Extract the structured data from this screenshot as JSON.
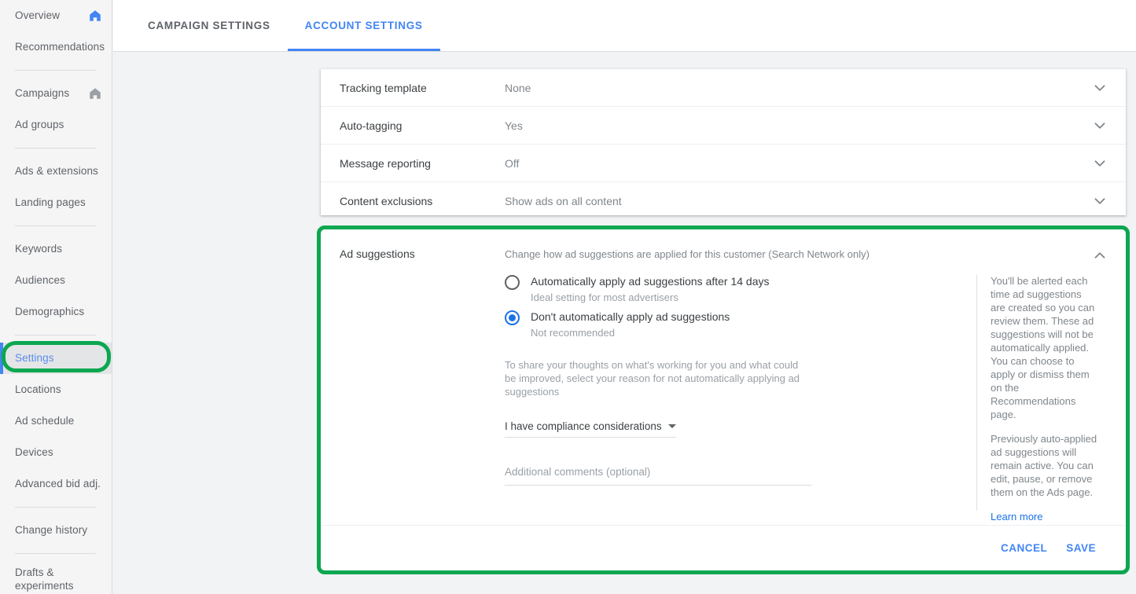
{
  "colors": {
    "accent_blue": "#4285f4",
    "link_blue": "#1a73e8",
    "highlight_green": "#0ca750",
    "sidebar_bg": "#f5f5f5",
    "content_bg": "#f1f3f4"
  },
  "sidebar": {
    "items": [
      {
        "label": "Overview",
        "icon": "home-icon",
        "icon_color": "blue",
        "selected": false
      },
      {
        "label": "Recommendations",
        "icon": null,
        "selected": false
      },
      {
        "separator": true
      },
      {
        "label": "Campaigns",
        "icon": "home-icon",
        "icon_color": "gray",
        "selected": false
      },
      {
        "label": "Ad groups",
        "icon": null,
        "selected": false
      },
      {
        "separator": true
      },
      {
        "label": "Ads & extensions",
        "icon": null,
        "selected": false
      },
      {
        "label": "Landing pages",
        "icon": null,
        "selected": false
      },
      {
        "separator": true
      },
      {
        "label": "Keywords",
        "icon": null,
        "selected": false
      },
      {
        "label": "Audiences",
        "icon": null,
        "selected": false
      },
      {
        "label": "Demographics",
        "icon": null,
        "selected": false
      },
      {
        "separator": true
      },
      {
        "label": "Settings",
        "icon": null,
        "selected": true
      },
      {
        "label": "Locations",
        "icon": null,
        "selected": false
      },
      {
        "label": "Ad schedule",
        "icon": null,
        "selected": false
      },
      {
        "label": "Devices",
        "icon": null,
        "selected": false
      },
      {
        "label": "Advanced bid adj.",
        "icon": null,
        "selected": false
      },
      {
        "separator": true
      },
      {
        "label": "Change history",
        "icon": null,
        "selected": false
      },
      {
        "separator": true
      },
      {
        "label": "Drafts & experiments",
        "icon": null,
        "selected": false,
        "two_line": true
      }
    ]
  },
  "tabs": [
    {
      "label": "CAMPAIGN SETTINGS",
      "active": false
    },
    {
      "label": "ACCOUNT SETTINGS",
      "active": true
    }
  ],
  "settings_rows": [
    {
      "label": "Tracking template",
      "value": "None",
      "icon": "chevron-down-icon"
    },
    {
      "label": "Auto-tagging",
      "value": "Yes",
      "icon": "chevron-down-icon"
    },
    {
      "label": "Message reporting",
      "value": "Off",
      "icon": "chevron-down-icon"
    },
    {
      "label": "Content exclusions",
      "value": "Show ads on all content",
      "icon": "chevron-down-icon"
    }
  ],
  "ad_suggestions": {
    "title": "Ad suggestions",
    "description": "Change how ad suggestions are applied for this customer (Search Network only)",
    "collapse_icon": "chevron-up-icon",
    "options": [
      {
        "label": "Automatically apply ad suggestions after 14 days",
        "sublabel": "Ideal setting for most advertisers",
        "checked": false
      },
      {
        "label": "Don't automatically apply ad suggestions",
        "sublabel": "Not recommended",
        "checked": true
      }
    ],
    "prompt": "To share your thoughts on what's working for you and what could be improved, select your reason for not automatically applying ad suggestions",
    "reason_select": {
      "value": "I have compliance considerations",
      "icon": "caret-down-icon"
    },
    "comments": {
      "value": "",
      "placeholder": "Additional comments (optional)"
    },
    "info": {
      "paragraph_1": "You'll be alerted each time ad suggestions are created so you can review them. These ad suggestions will not be automatically applied. You can choose to apply or dismiss them on the Recommendations page.",
      "paragraph_2": "Previously auto-applied ad suggestions will remain active. You can edit, pause, or remove them on the Ads page.",
      "link": "Learn more"
    },
    "actions": {
      "cancel": "CANCEL",
      "save": "SAVE"
    }
  }
}
